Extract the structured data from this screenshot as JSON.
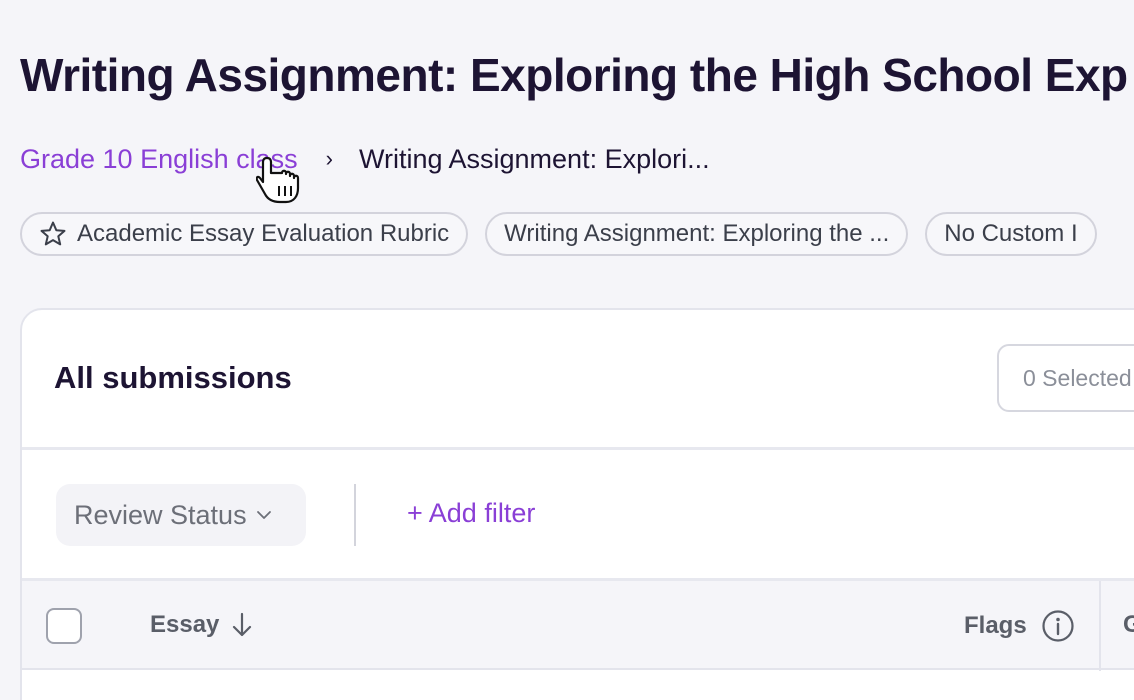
{
  "page": {
    "title": "Writing Assignment: Exploring the High School Exp"
  },
  "breadcrumb": {
    "parent": "Grade 10 English class",
    "separator": "›",
    "current": "Writing Assignment: Explori..."
  },
  "chips": [
    {
      "label": "Academic Essay Evaluation Rubric",
      "icon": "star-icon"
    },
    {
      "label": "Writing Assignment: Exploring the ..."
    },
    {
      "label": "No Custom I"
    }
  ],
  "submissions": {
    "title": "All submissions",
    "selected_label": "0 Selected"
  },
  "filters": {
    "review_status_label": "Review Status",
    "add_filter_label": "+ Add filter"
  },
  "table": {
    "columns": {
      "essay": "Essay",
      "flags": "Flags",
      "next": "G"
    }
  },
  "colors": {
    "accent": "#8a3fd6",
    "title": "#1d1433",
    "background": "#f5f5f9"
  }
}
